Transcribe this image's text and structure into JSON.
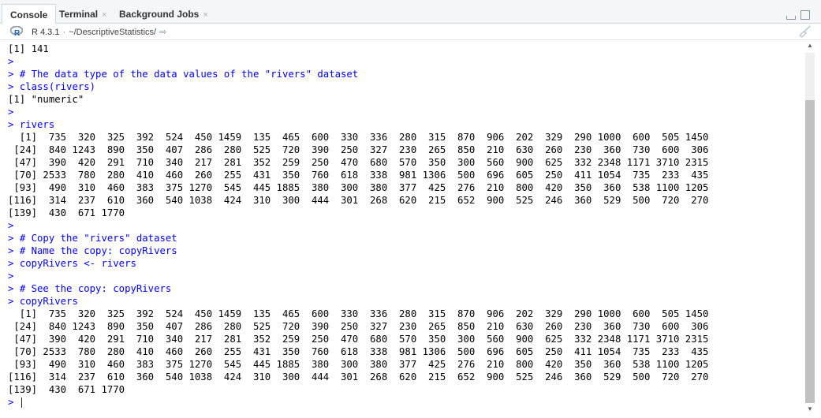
{
  "tabs": [
    {
      "label": "Console",
      "active": true,
      "closable": false
    },
    {
      "label": "Terminal",
      "active": false,
      "closable": true
    },
    {
      "label": "Background Jobs",
      "active": false,
      "closable": true
    }
  ],
  "toolbar": {
    "r_version": "R 4.3.1",
    "separator": "·",
    "working_dir": "~/DescriptiveStatistics/",
    "icons": [
      "r-logo-icon",
      "go-to-directory-icon",
      "clear-console-icon"
    ]
  },
  "window_controls": [
    "minimize-icon",
    "maximize-icon"
  ],
  "console": {
    "lines": [
      {
        "kind": "output",
        "text": "[1] 141"
      },
      {
        "kind": "prompt",
        "text": ""
      },
      {
        "kind": "prompt",
        "text": "# The data type of the data values of the \"rivers\" dataset"
      },
      {
        "kind": "prompt",
        "text": "class(rivers)"
      },
      {
        "kind": "output",
        "text": "[1] \"numeric\""
      },
      {
        "kind": "prompt",
        "text": ""
      },
      {
        "kind": "prompt",
        "text": "rivers"
      },
      {
        "kind": "output",
        "text": "  [1]  735  320  325  392  524  450 1459  135  465  600  330  336  280  315  870  906  202  329  290 1000  600  505 1450"
      },
      {
        "kind": "output",
        "text": " [24]  840 1243  890  350  407  286  280  525  720  390  250  327  230  265  850  210  630  260  230  360  730  600  306"
      },
      {
        "kind": "output",
        "text": " [47]  390  420  291  710  340  217  281  352  259  250  470  680  570  350  300  560  900  625  332 2348 1171 3710 2315"
      },
      {
        "kind": "output",
        "text": " [70] 2533  780  280  410  460  260  255  431  350  760  618  338  981 1306  500  696  605  250  411 1054  735  233  435"
      },
      {
        "kind": "output",
        "text": " [93]  490  310  460  383  375 1270  545  445 1885  380  300  380  377  425  276  210  800  420  350  360  538 1100 1205"
      },
      {
        "kind": "output",
        "text": "[116]  314  237  610  360  540 1038  424  310  300  444  301  268  620  215  652  900  525  246  360  529  500  720  270"
      },
      {
        "kind": "output",
        "text": "[139]  430  671 1770"
      },
      {
        "kind": "prompt",
        "text": ""
      },
      {
        "kind": "prompt",
        "text": "# Copy the \"rivers\" dataset"
      },
      {
        "kind": "prompt",
        "text": "# Name the copy: copyRivers"
      },
      {
        "kind": "prompt",
        "text": "copyRivers <- rivers"
      },
      {
        "kind": "prompt",
        "text": ""
      },
      {
        "kind": "prompt",
        "text": "# See the copy: copyRivers"
      },
      {
        "kind": "prompt",
        "text": "copyRivers"
      },
      {
        "kind": "output",
        "text": "  [1]  735  320  325  392  524  450 1459  135  465  600  330  336  280  315  870  906  202  329  290 1000  600  505 1450"
      },
      {
        "kind": "output",
        "text": " [24]  840 1243  890  350  407  286  280  525  720  390  250  327  230  265  850  210  630  260  230  360  730  600  306"
      },
      {
        "kind": "output",
        "text": " [47]  390  420  291  710  340  217  281  352  259  250  470  680  570  350  300  560  900  625  332 2348 1171 3710 2315"
      },
      {
        "kind": "output",
        "text": " [70] 2533  780  280  410  460  260  255  431  350  760  618  338  981 1306  500  696  605  250  411 1054  735  233  435"
      },
      {
        "kind": "output",
        "text": " [93]  490  310  460  383  375 1270  545  445 1885  380  300  380  377  425  276  210  800  420  350  360  538 1100 1205"
      },
      {
        "kind": "output",
        "text": "[116]  314  237  610  360  540 1038  424  310  300  444  301  268  620  215  652  900  525  246  360  529  500  720  270"
      },
      {
        "kind": "output",
        "text": "[139]  430  671 1770"
      },
      {
        "kind": "input",
        "text": ""
      }
    ],
    "prompt_symbol": ">",
    "colors": {
      "input": "#0000ff",
      "output": "#000000"
    }
  }
}
